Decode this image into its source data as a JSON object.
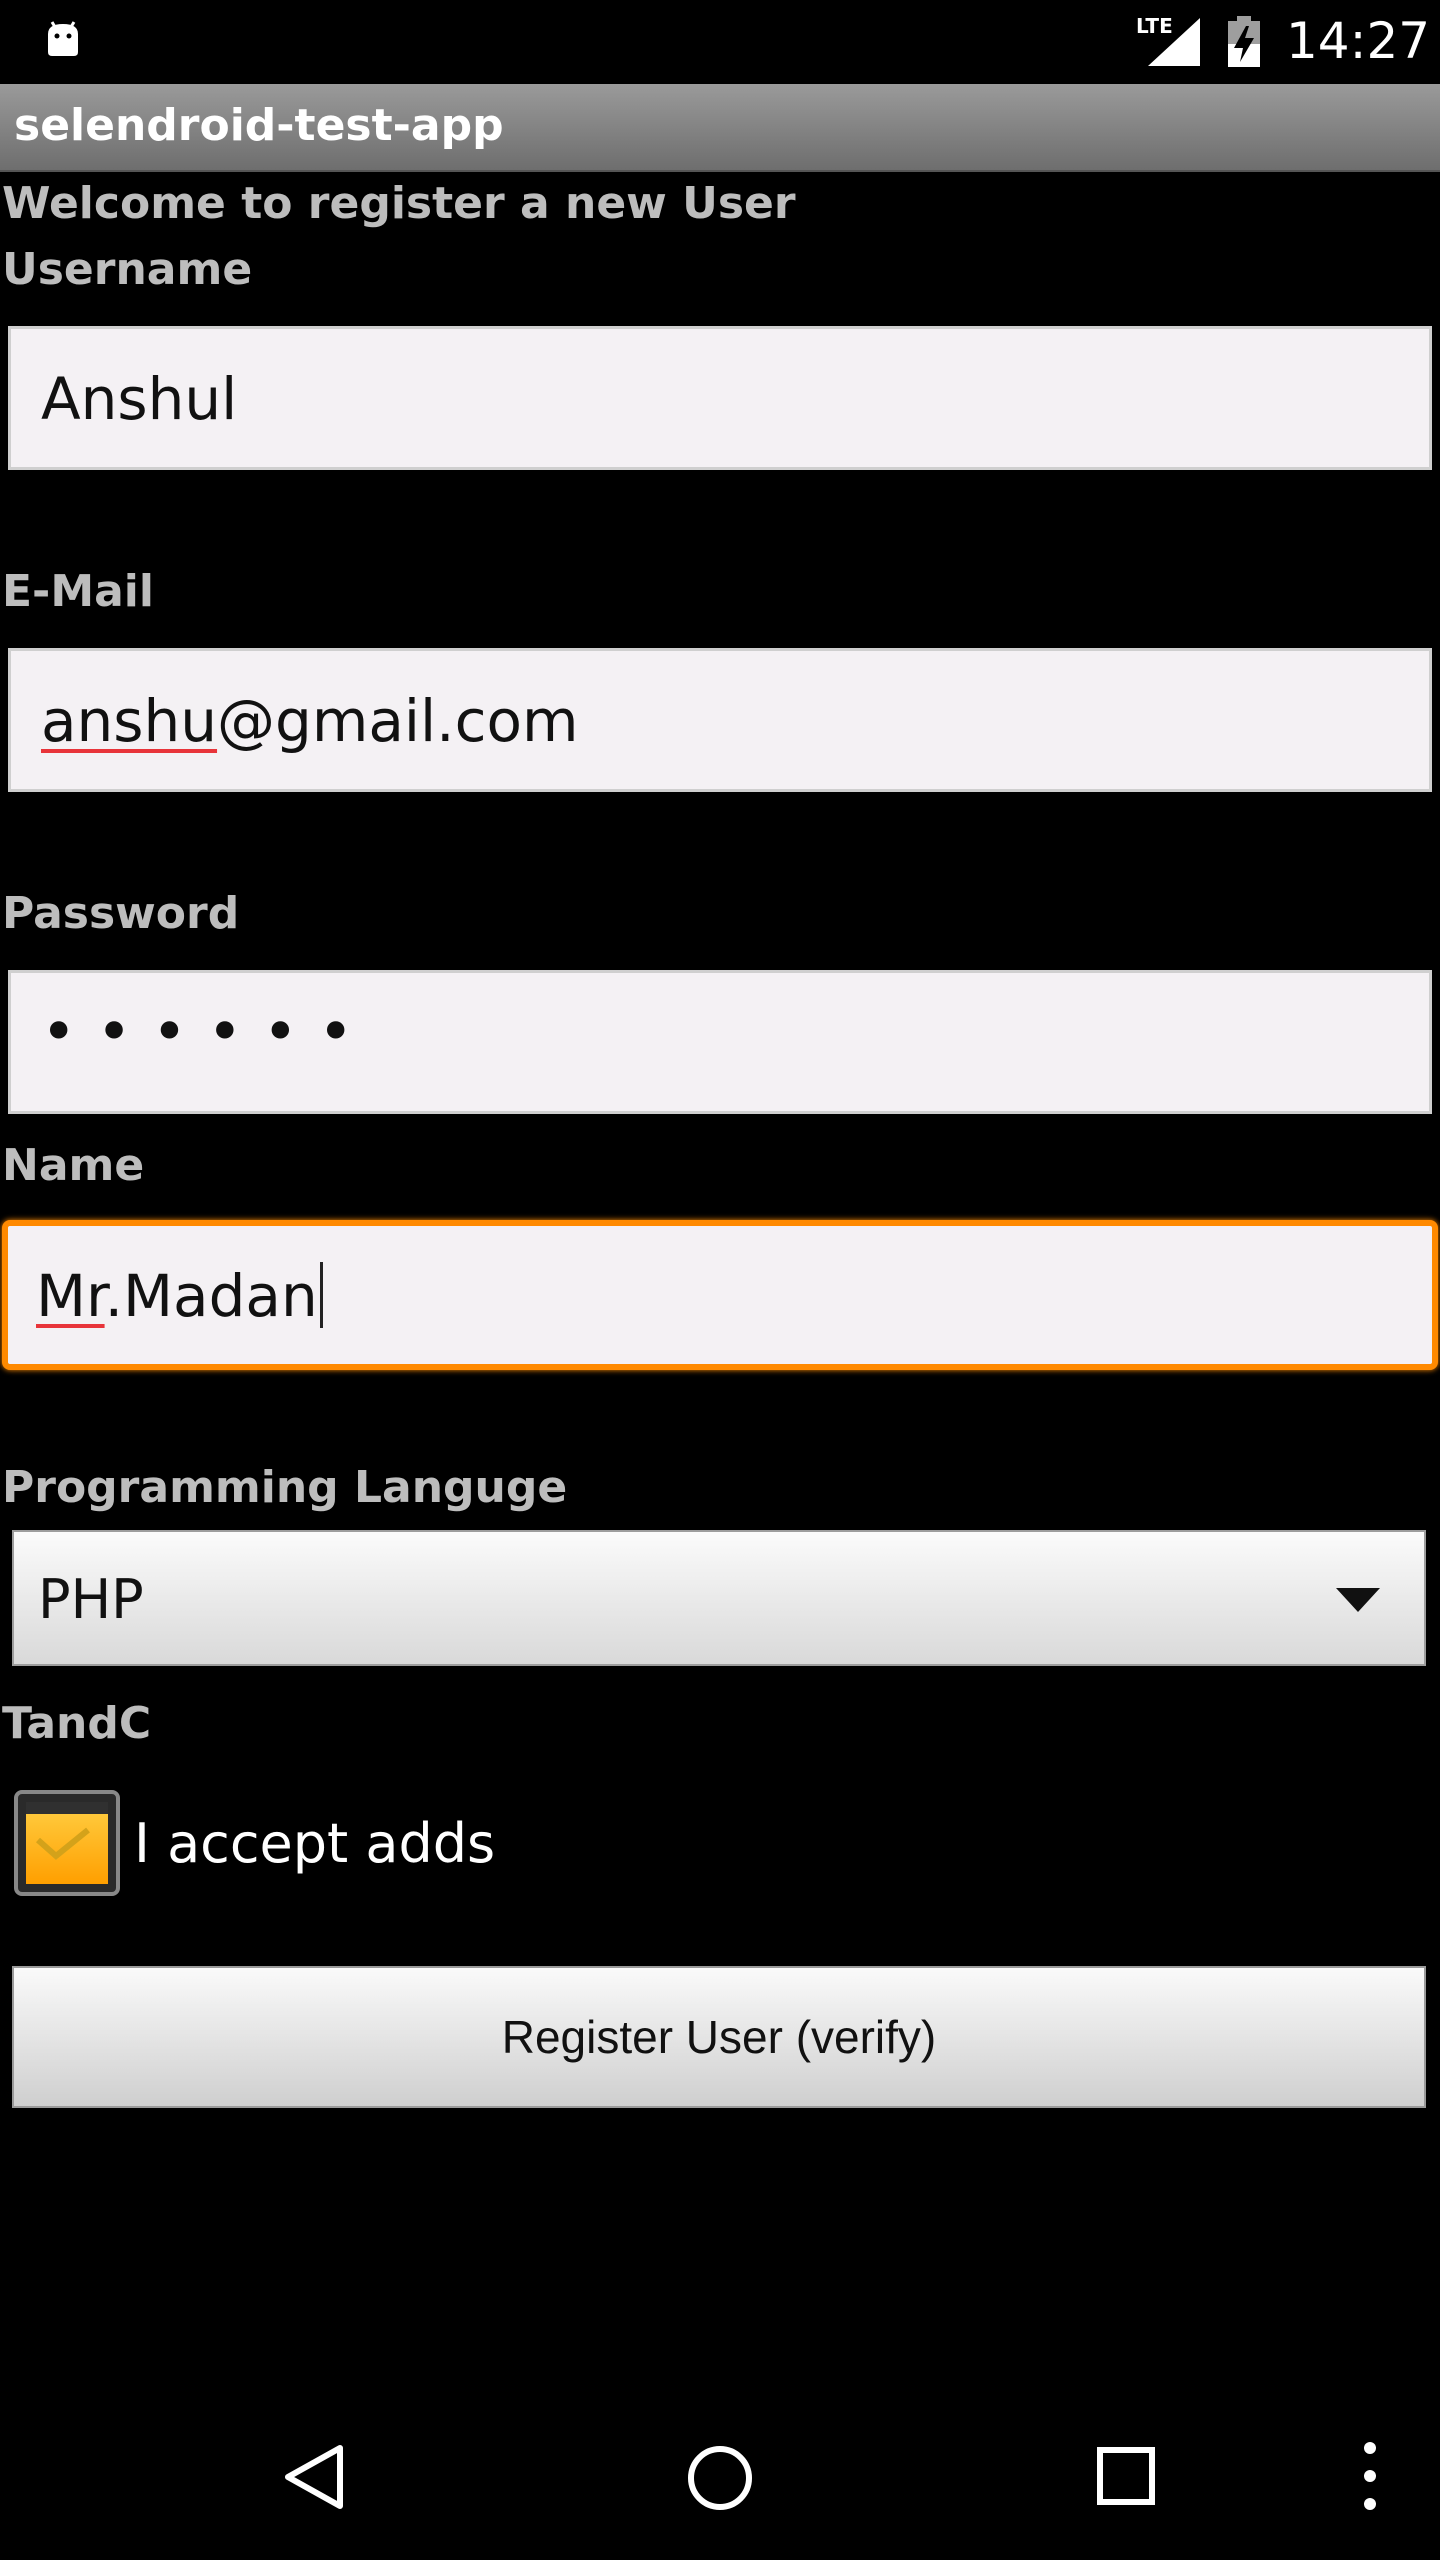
{
  "status_bar": {
    "network": "LTE",
    "time": "14:27",
    "icons": [
      "android-debug-icon",
      "signal-icon",
      "battery-icon"
    ]
  },
  "app_bar": {
    "title": "selendroid-test-app"
  },
  "form": {
    "welcome_text": "Welcome to register a new User",
    "username": {
      "label": "Username",
      "value": "Anshul"
    },
    "email": {
      "label": "E-Mail",
      "value_misspelled_part": "anshu",
      "value_rest": "@gmail.com"
    },
    "password": {
      "label": "Password",
      "masked_value": "••••••"
    },
    "name": {
      "label": "Name",
      "value_misspelled_part": "Mr",
      "value_rest": ".Madan",
      "focused": true
    },
    "language": {
      "label": "Programming Languge",
      "selected": "PHP"
    },
    "terms": {
      "label": "TandC",
      "checkbox_label": "I accept adds",
      "checked": true
    },
    "register_button_label": "Register User (verify)"
  },
  "nav_bar": {
    "icons": [
      "back-icon",
      "home-icon",
      "recents-icon",
      "overflow-menu-icon"
    ]
  },
  "colors": {
    "background": "#000000",
    "label_text": "#bdbdbd",
    "field_background": "#f4f1f4",
    "focus_accent": "#ff8a00",
    "checkbox_fill": "#ffb320",
    "spell_underline": "#e8343a"
  }
}
